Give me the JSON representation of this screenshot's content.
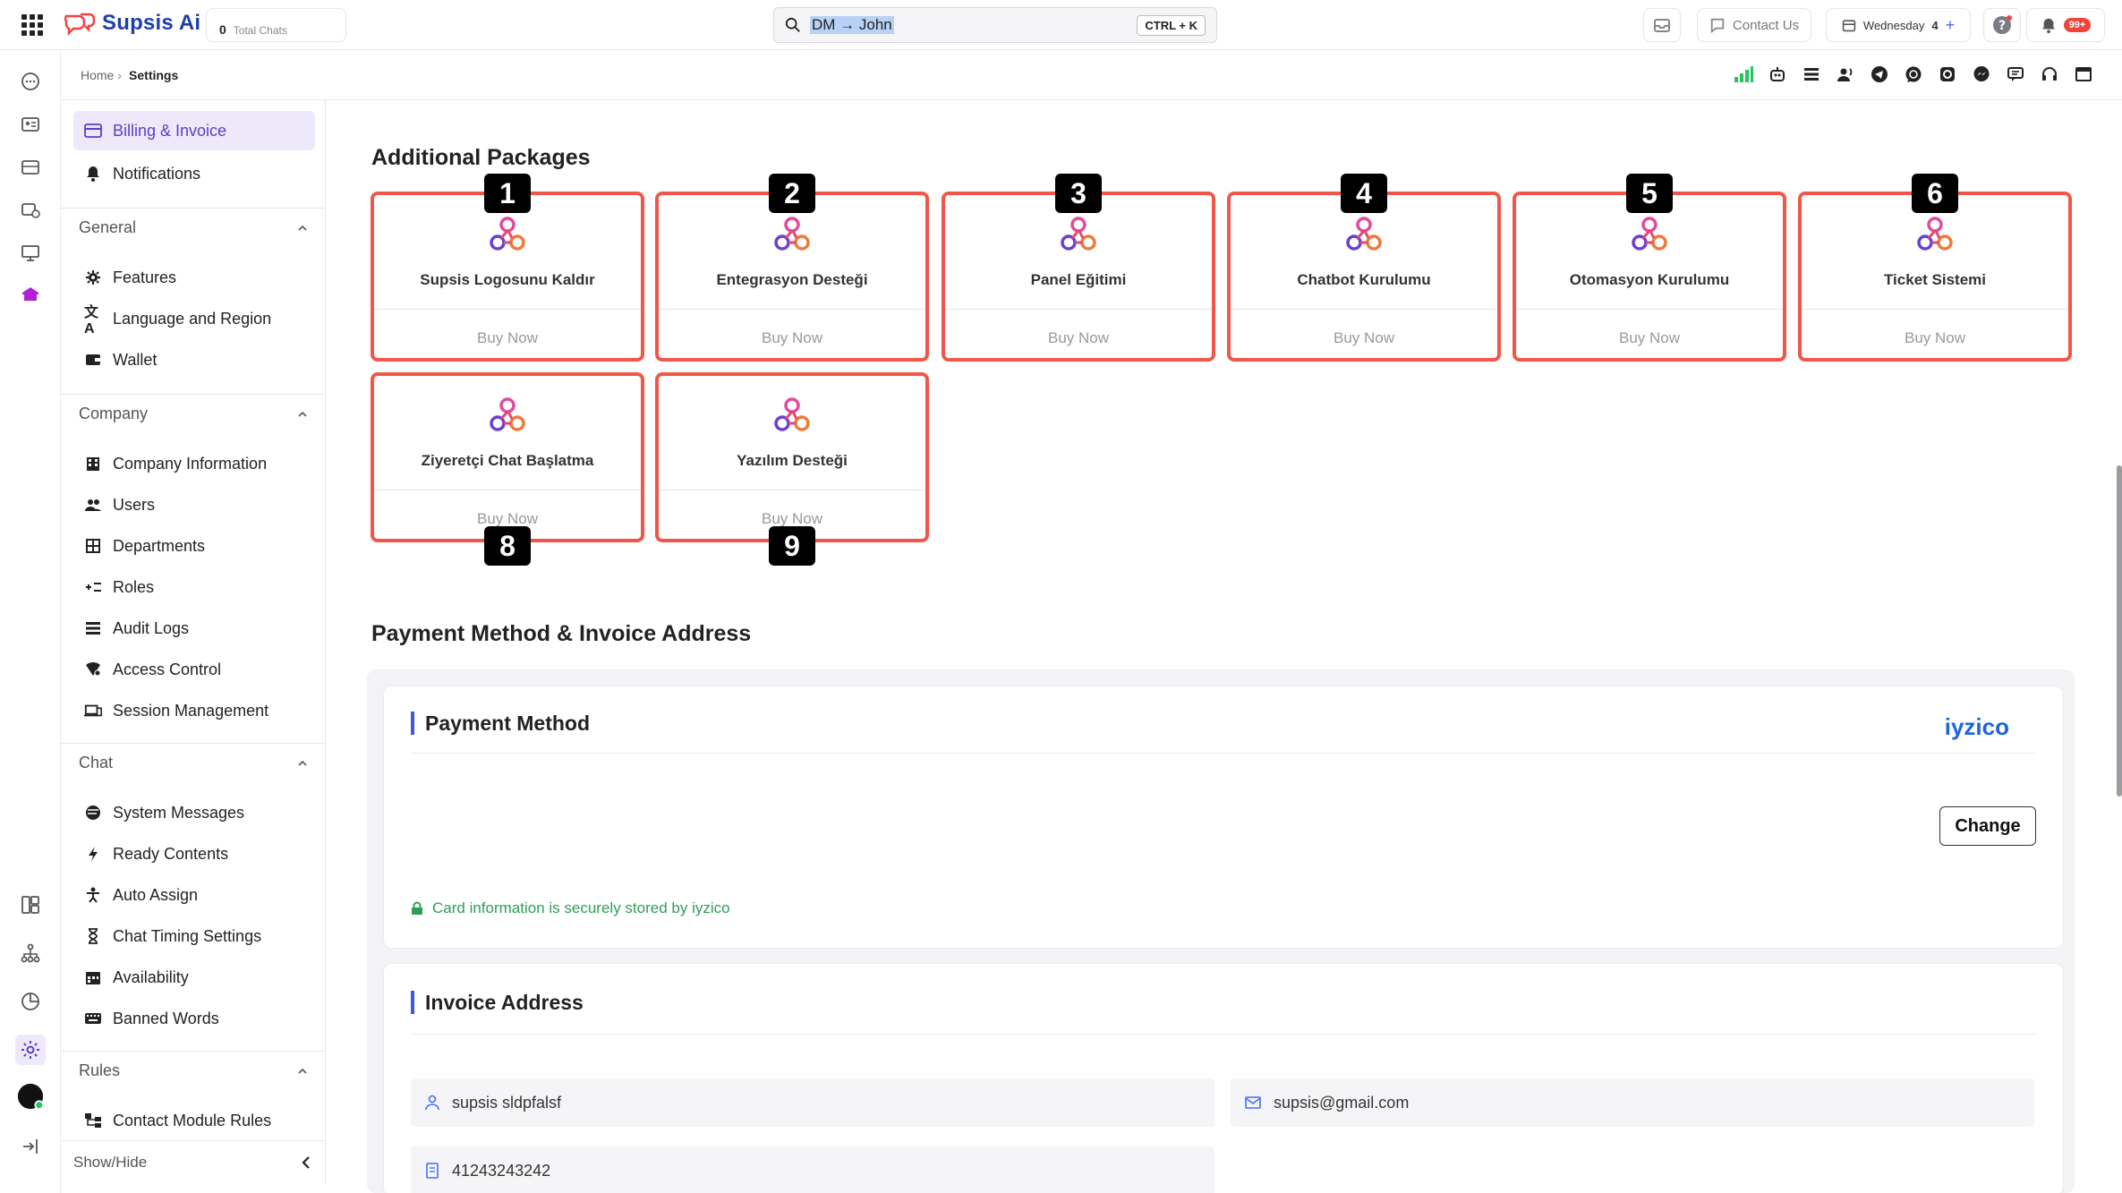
{
  "app": {
    "name": "Supsis Ai",
    "total_chats_value": "0",
    "total_chats_label": "Total Chats"
  },
  "search": {
    "value": "DM → John",
    "shortcut": "CTRL + K"
  },
  "topbar": {
    "contact_us": "Contact Us",
    "date_label": "Wednesday",
    "date_day": "4",
    "notifications_badge": "99+"
  },
  "breadcrumb": {
    "home": "Home",
    "current": "Settings"
  },
  "channels": [
    "signal-bars-icon",
    "bot-icon",
    "list-icon",
    "users-voice-icon",
    "telegram-icon",
    "whatsapp-icon",
    "instagram-icon",
    "messenger-icon",
    "chat-widget-icon",
    "headset-icon",
    "window-icon"
  ],
  "sidebar": {
    "top_items": [
      {
        "label": "Billing & Invoice",
        "icon": "card-icon",
        "active": true
      },
      {
        "label": "Notifications",
        "icon": "bell-icon",
        "active": false
      }
    ],
    "sections": [
      {
        "title": "General",
        "items": [
          {
            "label": "Features",
            "icon": "gear-icon"
          },
          {
            "label": "Language and Region",
            "icon": "translate-icon"
          },
          {
            "label": "Wallet",
            "icon": "wallet-icon"
          }
        ]
      },
      {
        "title": "Company",
        "items": [
          {
            "label": "Company Information",
            "icon": "building-icon"
          },
          {
            "label": "Users",
            "icon": "users-icon"
          },
          {
            "label": "Departments",
            "icon": "departments-icon"
          },
          {
            "label": "Roles",
            "icon": "roles-icon"
          },
          {
            "label": "Audit Logs",
            "icon": "list-icon"
          },
          {
            "label": "Access Control",
            "icon": "shield-icon"
          },
          {
            "label": "Session Management",
            "icon": "devices-icon"
          }
        ]
      },
      {
        "title": "Chat",
        "items": [
          {
            "label": "System Messages",
            "icon": "message-icon"
          },
          {
            "label": "Ready Contents",
            "icon": "bolt-icon"
          },
          {
            "label": "Auto Assign",
            "icon": "person-icon"
          },
          {
            "label": "Chat Timing Settings",
            "icon": "hourglass-icon"
          },
          {
            "label": "Availability",
            "icon": "calendar-icon"
          },
          {
            "label": "Banned Words",
            "icon": "keyboard-icon"
          }
        ]
      },
      {
        "title": "Rules",
        "items": [
          {
            "label": "Contact Module Rules",
            "icon": "rules-icon"
          }
        ]
      }
    ],
    "show_hide": "Show/Hide"
  },
  "additional_packages": {
    "title": "Additional Packages",
    "buy_label": "Buy Now",
    "items": [
      {
        "name": "Supsis Logosunu Kaldır",
        "badge": "1"
      },
      {
        "name": "Entegrasyon Desteği",
        "badge": "2"
      },
      {
        "name": "Panel Eğitimi",
        "badge": "3"
      },
      {
        "name": "Chatbot Kurulumu",
        "badge": "4"
      },
      {
        "name": "Otomasyon Kurulumu",
        "badge": "5"
      },
      {
        "name": "Ticket Sistemi",
        "badge": "6"
      },
      {
        "name": "Ziyeretçi Chat Başlatma",
        "badge": "8"
      },
      {
        "name": "Yazılım Desteği",
        "badge": "9"
      }
    ]
  },
  "payment": {
    "section_title": "Payment Method & Invoice Address",
    "card_title": "Payment Method",
    "provider": "iyzico",
    "change_label": "Change",
    "secure_note": "Card information is securely stored by iyzico"
  },
  "invoice": {
    "title": "Invoice Address",
    "name": "supsis sldpfalsf",
    "email": "supsis@gmail.com",
    "tax_id": "41243243242"
  },
  "colors": {
    "accent": "#5b3fc4",
    "highlight_border": "#f0574a",
    "brand": "#1f3fa8",
    "iyzico": "#1e64e0",
    "secure": "#2e9e56"
  }
}
